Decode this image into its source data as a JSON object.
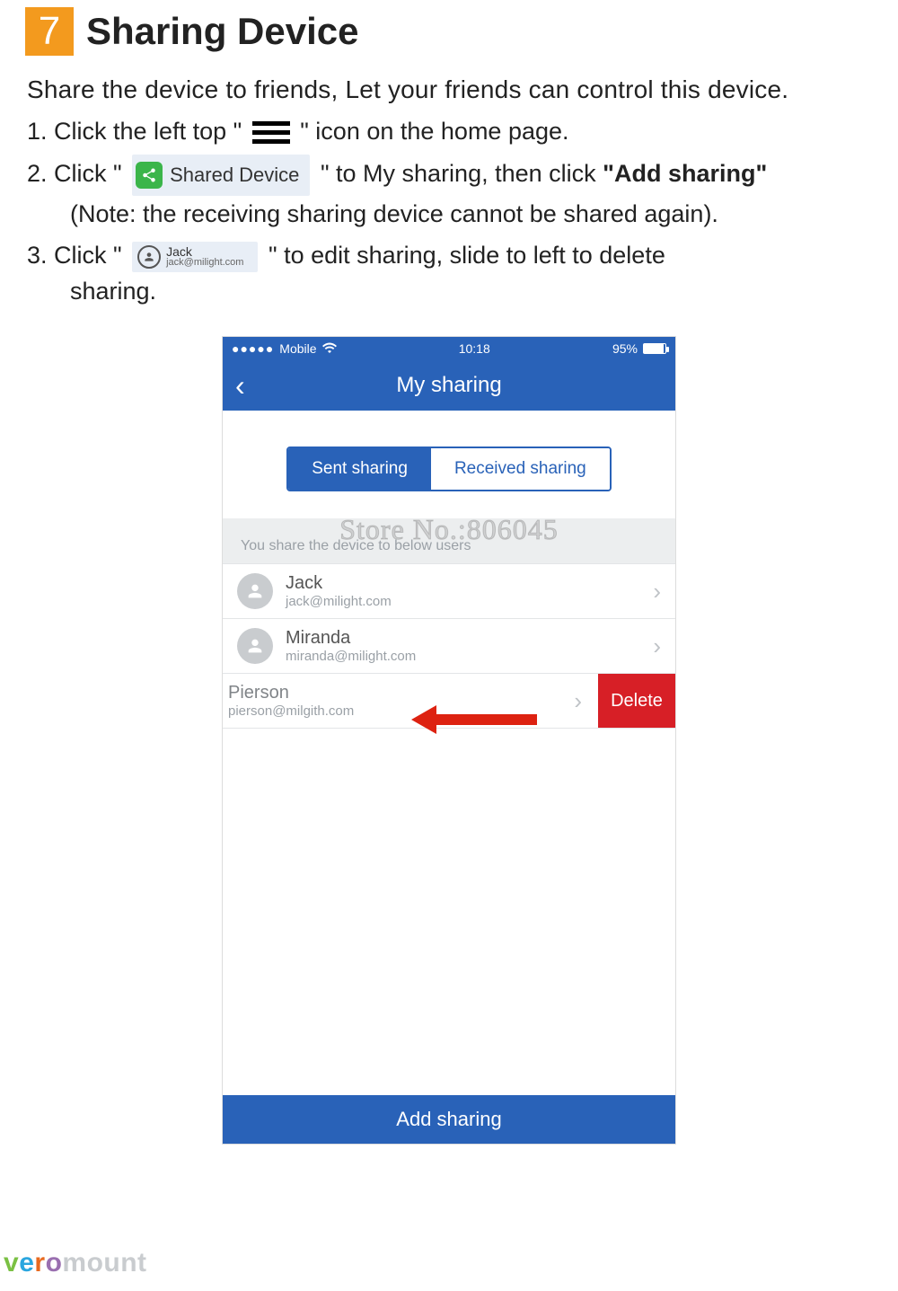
{
  "section": {
    "number": "7",
    "title": "Sharing Device"
  },
  "lead": "Share the device to friends, Let your friends can control this device.",
  "steps": {
    "s1a": "1. Click the left top \" ",
    "s1b": " \" icon on the home page.",
    "s2a": "2. Click \" ",
    "s2b": " \" to My sharing, then click",
    "s2bold": "\"Add sharing\"",
    "s2note": "(Note: the receiving sharing device cannot be shared again).",
    "s3a": "3. Click \" ",
    "s3b": " \" to edit sharing, slide to left to delete",
    "s3c": "sharing."
  },
  "pill_share": {
    "label": "Shared Device"
  },
  "pill_contact": {
    "name": "Jack",
    "email": "jack@milight.com"
  },
  "phone": {
    "status": {
      "carrier": "Mobile",
      "time": "10:18",
      "battery": "95%"
    },
    "nav_title": "My sharing",
    "segments": {
      "left": "Sent sharing",
      "right": "Received sharing"
    },
    "section_label": "You share the device to below users",
    "watermark": "Store No.:806045",
    "rows": [
      {
        "name": "Jack",
        "email": "jack@milight.com"
      },
      {
        "name": "Miranda",
        "email": "miranda@milight.com"
      }
    ],
    "swiped": {
      "name": "Pierson",
      "email": "pierson@milgith.com",
      "delete": "Delete"
    },
    "add_label": "Add sharing"
  },
  "brand": {
    "v": "v",
    "e": "e",
    "r": "r",
    "o": "o",
    "rest": "mount"
  }
}
